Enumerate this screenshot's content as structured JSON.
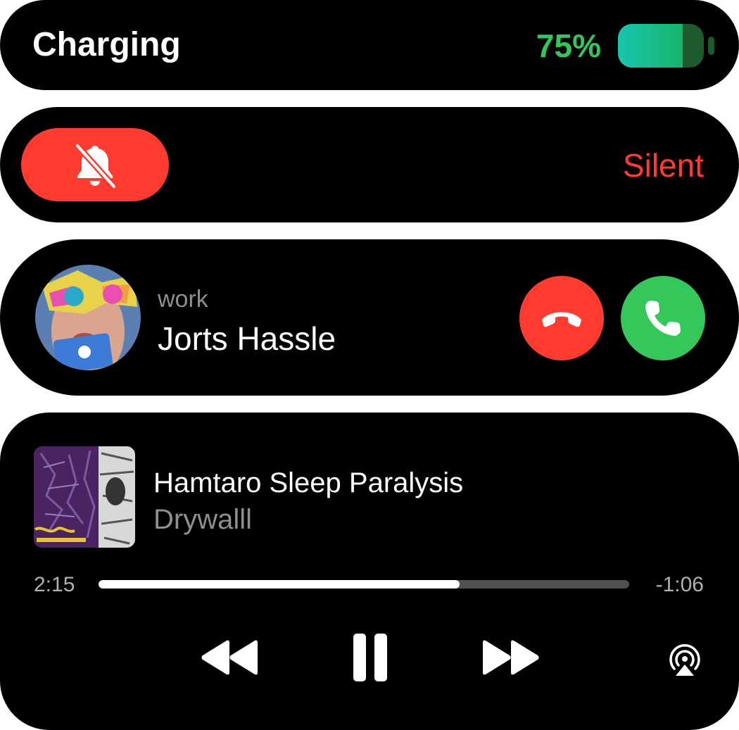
{
  "charging": {
    "label": "Charging",
    "percent_text": "75%",
    "level": 0.75,
    "accent": "#30c85a"
  },
  "silent": {
    "label": "Silent",
    "icon": "bell-slash-icon",
    "accent": "#ff3b30"
  },
  "call": {
    "subtitle": "work",
    "caller_name": "Jorts Hassle",
    "decline_icon": "phone-down-icon",
    "accept_icon": "phone-icon",
    "decline_color": "#ff3b30",
    "accept_color": "#34c759"
  },
  "now_playing": {
    "title": "Hamtaro Sleep Paralysis",
    "artist": "Drywalll",
    "elapsed": "2:15",
    "remaining": "-1:06",
    "progress": 0.68,
    "controls": [
      "rewind-icon",
      "pause-icon",
      "fast-forward-icon",
      "airplay-icon"
    ]
  }
}
